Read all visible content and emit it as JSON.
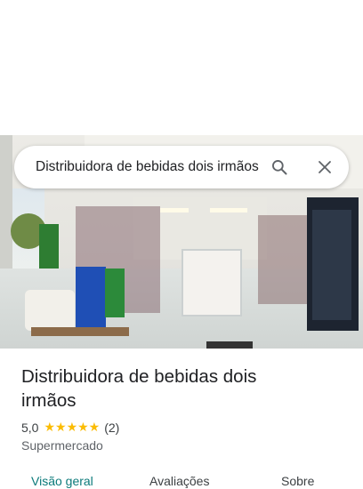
{
  "search": {
    "query": "Distribuidora de bebidas dois irmãos"
  },
  "place": {
    "title": "Distribuidora de bebidas dois irmãos",
    "rating": "5,0",
    "stars": "★★★★★",
    "review_count": "(2)",
    "category": "Supermercado"
  },
  "tabs": [
    {
      "label": "Visão geral",
      "active": true
    },
    {
      "label": "Avaliações",
      "active": false
    },
    {
      "label": "Sobre",
      "active": false
    }
  ],
  "icons": {
    "search": "search-icon",
    "close": "close-icon"
  },
  "colors": {
    "stars": "#fbbc04",
    "active_tab": "#0b7a7a"
  }
}
